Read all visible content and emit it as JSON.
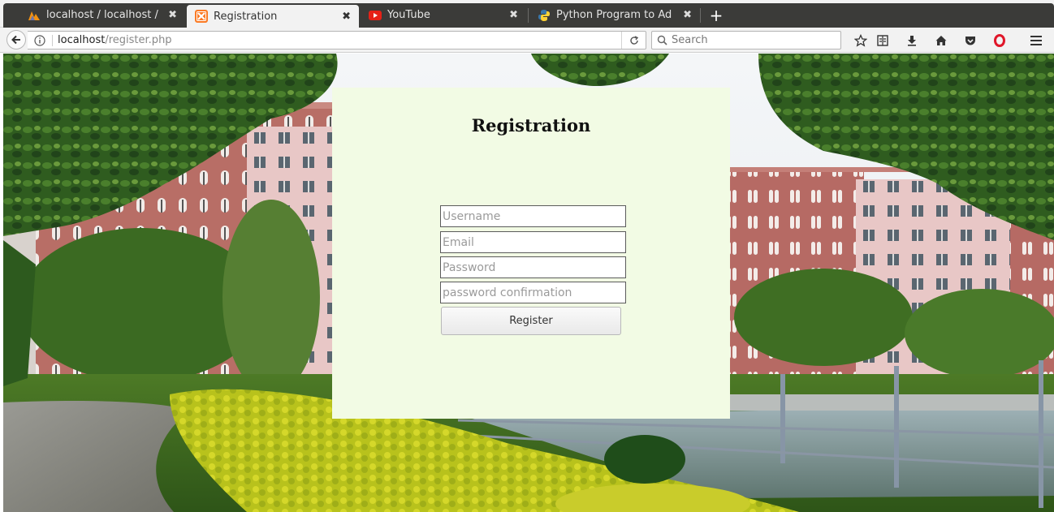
{
  "browser": {
    "tabs": [
      {
        "title": "localhost / localhost / ",
        "favicon": "phpmyadmin-icon",
        "active": false
      },
      {
        "title": "Registration",
        "favicon": "xampp-icon",
        "active": true
      },
      {
        "title": "YouTube",
        "favicon": "youtube-icon",
        "active": false
      },
      {
        "title": "Python Program to Ad",
        "favicon": "python-icon",
        "active": false
      }
    ],
    "url_host": "localhost",
    "url_path": "/register.php",
    "search_placeholder": "Search"
  },
  "colors": {
    "tabbar_bg": "#3b3b39",
    "panel_bg": "#f2fbe4",
    "opera_red": "#e0172a",
    "youtube_red": "#e62117",
    "xampp_orange": "#fb7a24"
  },
  "page": {
    "title": "Registration",
    "fields": {
      "username_placeholder": "Username",
      "email_placeholder": "Email",
      "password_placeholder": "Password",
      "confirm_placeholder": "password confirmation"
    },
    "register_label": "Register"
  }
}
